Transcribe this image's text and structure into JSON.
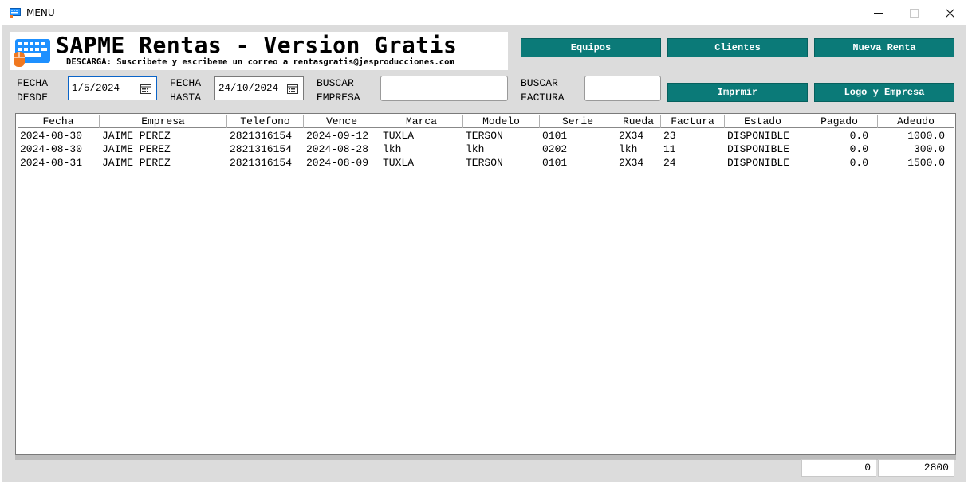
{
  "window": {
    "title": "MENU"
  },
  "banner": {
    "title": "SAPME Rentas - Version Gratis",
    "subtitle": "DESCARGA: Suscribete y escribeme un correo a rentasgratis@jesproducciones.com"
  },
  "buttons": {
    "equipos": "Equipos",
    "clientes": "Clientes",
    "nueva_renta": "Nueva Renta",
    "imprimir": "Imprmir",
    "logo_empresa": "Logo y Empresa"
  },
  "filters": {
    "fecha_desde_label_1": "FECHA",
    "fecha_desde_label_2": "DESDE",
    "fecha_desde_value": "1/5/2024",
    "fecha_hasta_label_1": "FECHA",
    "fecha_hasta_label_2": "HASTA",
    "fecha_hasta_value": "24/10/2024",
    "buscar_empresa_label_1": "BUSCAR",
    "buscar_empresa_label_2": "EMPRESA",
    "buscar_empresa_value": "",
    "buscar_factura_label_1": "BUSCAR",
    "buscar_factura_label_2": "FACTURA",
    "buscar_factura_value": ""
  },
  "table": {
    "columns": [
      "Fecha",
      "Empresa",
      "Telefono",
      "Vence",
      "Marca",
      "Modelo",
      "Serie",
      "Rueda",
      "Factura",
      "Estado",
      "Pagado",
      "Adeudo"
    ],
    "rows": [
      [
        "2024-08-30",
        "JAIME PEREZ",
        "2821316154",
        "2024-09-12",
        "TUXLA",
        "TERSON",
        "0101",
        "2X34",
        "23",
        "DISPONIBLE",
        "0.0",
        "1000.0"
      ],
      [
        "2024-08-30",
        "JAIME PEREZ",
        "2821316154",
        "2024-08-28",
        "lkh",
        "lkh",
        "0202",
        "lkh",
        "11",
        "DISPONIBLE",
        "0.0",
        "300.0"
      ],
      [
        "2024-08-31",
        "JAIME PEREZ",
        "2821316154",
        "2024-08-09",
        "TUXLA",
        "TERSON",
        "0101",
        "2X34",
        "24",
        "DISPONIBLE",
        "0.0",
        "1500.0"
      ]
    ]
  },
  "totals": {
    "pagado": "0",
    "adeudo": "2800"
  },
  "colors": {
    "button": "#0b7a78",
    "background": "#dcdcdc",
    "icon_blue": "#1e90ff",
    "icon_orange": "#f07820"
  },
  "icons": [
    "app-icon",
    "keyboard-icon",
    "calendar-icon",
    "minimize-icon",
    "maximize-icon",
    "close-icon"
  ]
}
